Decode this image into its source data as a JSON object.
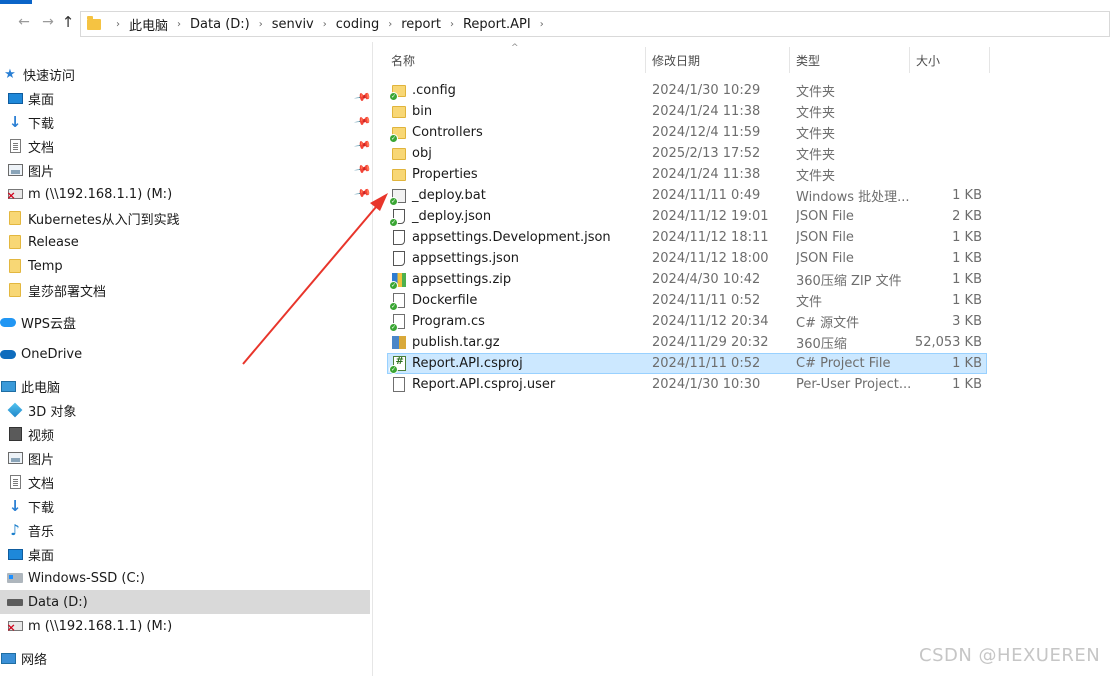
{
  "address_bar": {
    "breadcrumbs": [
      "此电脑",
      "Data (D:)",
      "senviv",
      "coding",
      "report",
      "Report.API"
    ]
  },
  "sidebar": {
    "quick_access": "快速访问",
    "pinned": [
      {
        "label": "桌面",
        "icon": "desktop-icon"
      },
      {
        "label": "下载",
        "icon": "download-icon"
      },
      {
        "label": "文档",
        "icon": "document-icon"
      },
      {
        "label": "图片",
        "icon": "picture-icon"
      },
      {
        "label": "m (\\\\192.168.1.1) (M:)",
        "icon": "network-drive-icon"
      }
    ],
    "folders": [
      "Kubernetes从入门到实践",
      "Release",
      "Temp",
      "皇莎部署文档"
    ],
    "wps_cloud": "WPS云盘",
    "onedrive": "OneDrive",
    "this_pc": "此电脑",
    "pc_items": [
      {
        "label": "3D 对象",
        "icon": "3d-objects-icon"
      },
      {
        "label": "视频",
        "icon": "video-icon"
      },
      {
        "label": "图片",
        "icon": "picture-icon"
      },
      {
        "label": "文档",
        "icon": "document-icon"
      },
      {
        "label": "下载",
        "icon": "download-icon"
      },
      {
        "label": "音乐",
        "icon": "music-icon"
      },
      {
        "label": "桌面",
        "icon": "desktop-icon"
      },
      {
        "label": "Windows-SSD (C:)",
        "icon": "windows-drive-icon"
      },
      {
        "label": "Data (D:)",
        "icon": "drive-icon"
      },
      {
        "label": "m (\\\\192.168.1.1) (M:)",
        "icon": "network-drive-icon"
      }
    ],
    "network": "网络"
  },
  "columns": {
    "name": "名称",
    "date": "修改日期",
    "type": "类型",
    "size": "大小"
  },
  "files": [
    {
      "name": ".config",
      "date": "2024/1/30 10:29",
      "type": "文件夹",
      "size": "",
      "icon": "folder-icon",
      "synced": true
    },
    {
      "name": "bin",
      "date": "2024/1/24 11:38",
      "type": "文件夹",
      "size": "",
      "icon": "folder-icon",
      "synced": false
    },
    {
      "name": "Controllers",
      "date": "2024/12/4 11:59",
      "type": "文件夹",
      "size": "",
      "icon": "folder-icon",
      "synced": true
    },
    {
      "name": "obj",
      "date": "2025/2/13 17:52",
      "type": "文件夹",
      "size": "",
      "icon": "folder-icon",
      "synced": false
    },
    {
      "name": "Properties",
      "date": "2024/1/24 11:38",
      "type": "文件夹",
      "size": "",
      "icon": "folder-icon",
      "synced": false
    },
    {
      "name": "_deploy.bat",
      "date": "2024/11/11 0:49",
      "type": "Windows 批处理...",
      "size": "1 KB",
      "icon": "batch-file-icon",
      "synced": true
    },
    {
      "name": "_deploy.json",
      "date": "2024/11/12 19:01",
      "type": "JSON File",
      "size": "2 KB",
      "icon": "json-file-icon",
      "synced": true
    },
    {
      "name": "appsettings.Development.json",
      "date": "2024/11/12 18:11",
      "type": "JSON File",
      "size": "1 KB",
      "icon": "json-file-icon",
      "synced": false
    },
    {
      "name": "appsettings.json",
      "date": "2024/11/12 18:00",
      "type": "JSON File",
      "size": "1 KB",
      "icon": "json-file-icon",
      "synced": false
    },
    {
      "name": "appsettings.zip",
      "date": "2024/4/30 10:42",
      "type": "360压缩 ZIP 文件",
      "size": "1 KB",
      "icon": "zip-file-icon",
      "synced": true
    },
    {
      "name": "Dockerfile",
      "date": "2024/11/11 0:52",
      "type": "文件",
      "size": "1 KB",
      "icon": "file-icon",
      "synced": true
    },
    {
      "name": "Program.cs",
      "date": "2024/11/12 20:34",
      "type": "C# 源文件",
      "size": "3 KB",
      "icon": "csharp-file-icon",
      "synced": true
    },
    {
      "name": "publish.tar.gz",
      "date": "2024/11/29 20:32",
      "type": "360压缩",
      "size": "52,053 KB",
      "icon": "archive-file-icon",
      "synced": false
    },
    {
      "name": "Report.API.csproj",
      "date": "2024/11/11 0:52",
      "type": "C# Project File",
      "size": "1 KB",
      "icon": "csproj-file-icon",
      "synced": true,
      "selected": true
    },
    {
      "name": "Report.API.csproj.user",
      "date": "2024/1/30 10:30",
      "type": "Per-User Project...",
      "size": "1 KB",
      "icon": "file-icon",
      "synced": false
    }
  ],
  "watermark": "CSDN @HEXUEREN",
  "colors": {
    "accent": "#0a64c8",
    "selection": "#cce8ff",
    "folder": "#f8d775",
    "annotation_arrow": "#e8352b"
  }
}
